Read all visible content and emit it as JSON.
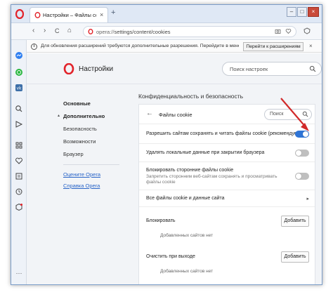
{
  "tab": {
    "title": "Настройки – Файлы cookie",
    "close": "×",
    "new_tab": "+"
  },
  "window_controls": {
    "minimize": "–",
    "maximize": "□",
    "close": "×"
  },
  "address": {
    "url_prefix": "opera://",
    "url_path": "settings/content/cookies",
    "back": "‹",
    "forward": "›",
    "reload": "C",
    "home": "⌂"
  },
  "notice": {
    "text": "Для обновления расширений требуются дополнительные разрешения. Перейдите в менеджер р...",
    "button": "Перейти к расширениям",
    "close": "×"
  },
  "settings": {
    "title": "Настройки",
    "search_placeholder": "Поиск настроек"
  },
  "nav": {
    "items": [
      {
        "label": "Основные"
      },
      {
        "label": "Дополнительно"
      },
      {
        "label": "Безопасность"
      },
      {
        "label": "Возможности"
      },
      {
        "label": "Браузер"
      }
    ],
    "links": [
      {
        "label": "Оцените Opera"
      },
      {
        "label": "Справка Opera"
      }
    ],
    "expand_marker": "▴"
  },
  "main": {
    "section_title": "Конфиденциальность и безопасность",
    "card_title": "Файлы cookie",
    "back": "←",
    "search_placeholder": "Поиск",
    "rows": [
      {
        "label": "Разрешить сайтам сохранять и читать файлы cookie (рекомендуется)",
        "state": "on"
      },
      {
        "label": "Удалять локальные данные при закрытии браузера",
        "state": "off"
      },
      {
        "label": "Блокировать сторонние файлы cookie",
        "sub": "Запретить сторонним веб-сайтам сохранять и просматривать файлы cookie",
        "state": "off"
      },
      {
        "label": "Все файлы cookie и данные сайта",
        "chevron": "▸"
      }
    ],
    "blocks": [
      {
        "label": "Блокировать",
        "button": "Добавить",
        "empty": "Добавленных сайтов нет"
      },
      {
        "label": "Очистить при выходе",
        "button": "Добавить",
        "empty": "Добавленных сайтов нет"
      }
    ]
  },
  "colors": {
    "accent": "#2e74d6",
    "opera_red": "#e2232a",
    "annotation_arrow": "#d12a2a"
  },
  "sidebar_icons": [
    "messenger-icon",
    "whatsapp-icon",
    "vk-icon",
    "search-icon",
    "send-icon",
    "speed-dial-icon",
    "heart-icon",
    "news-icon",
    "history-icon",
    "extensions-icon",
    "more-icon"
  ]
}
